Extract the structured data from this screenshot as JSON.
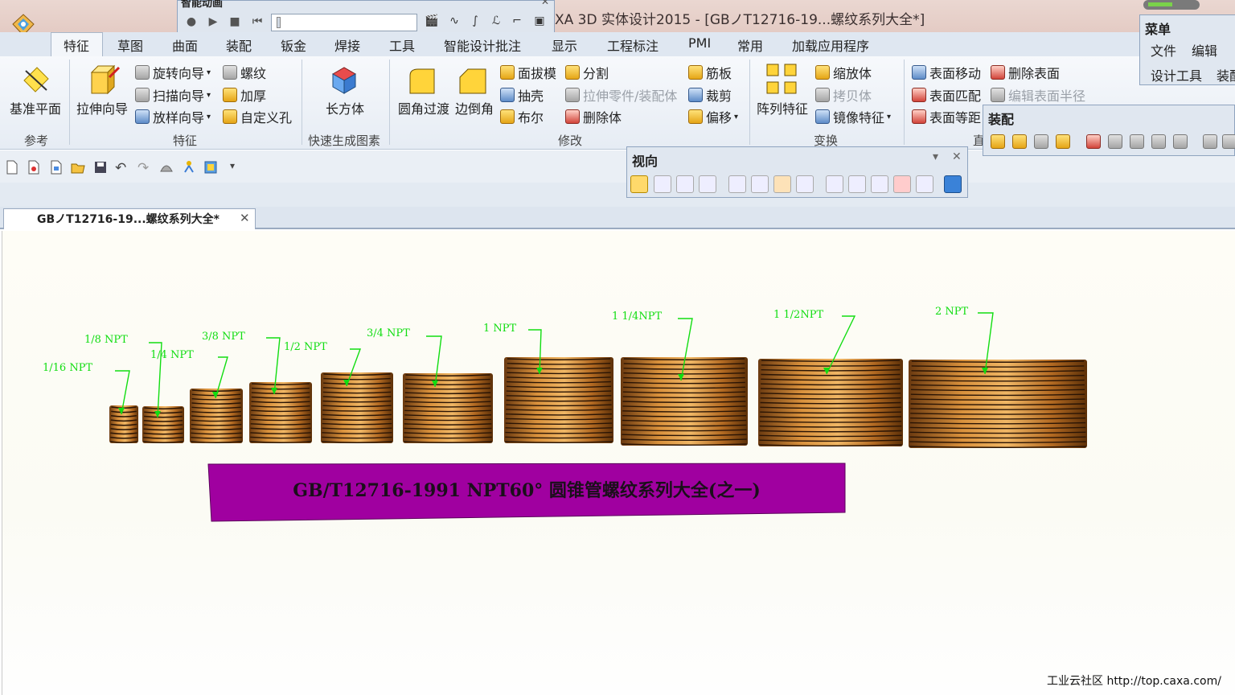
{
  "window": {
    "title": "XA 3D 实体设计2015 - [GBノT12716-19...螺纹系列大全*]"
  },
  "anim_toolbar": {
    "title": "智能动画"
  },
  "menu_tabs": [
    {
      "label": "特征"
    },
    {
      "label": "草图"
    },
    {
      "label": "曲面"
    },
    {
      "label": "装配"
    },
    {
      "label": "钣金"
    },
    {
      "label": "焊接"
    },
    {
      "label": "工具"
    },
    {
      "label": "智能设计批注"
    },
    {
      "label": "显示"
    },
    {
      "label": "工程标注"
    },
    {
      "label": "PMI"
    },
    {
      "label": "常用"
    },
    {
      "label": "加载应用程序"
    }
  ],
  "ribbon": {
    "groups": {
      "reference": "参考",
      "features": "特征",
      "quick": "快速生成图素",
      "modify": "修改",
      "transform": "变换"
    },
    "reference": {
      "datum_plane": "基准平面"
    },
    "features": {
      "extrude_wizard": "拉伸向导",
      "revolve_wizard": "旋转向导",
      "sweep_wizard": "扫描向导",
      "loft_wizard": "放样向导",
      "thread": "螺纹",
      "thicken": "加厚",
      "custom_hole": "自定义孔"
    },
    "quick": {
      "box": "长方体"
    },
    "modify": {
      "fillet": "圆角过渡",
      "chamfer": "边倒角",
      "draft": "面拔模",
      "split": "分割",
      "rib": "筋板",
      "shell": "抽壳",
      "extrude_part": "拉伸零件/装配体",
      "trim": "裁剪",
      "boolean": "布尔",
      "delete_body": "删除体",
      "offset": "偏移"
    },
    "transform": {
      "pattern": "阵列特征",
      "scale": "缩放体",
      "copy": "拷贝体",
      "mirror": "镜像特征"
    },
    "direct_edit": {
      "move_face": "表面移动",
      "match_face": "表面匹配",
      "offset_face": "表面等距",
      "delete_face": "删除表面",
      "edit_radius": "编辑表面半径",
      "group_label_partial": "直"
    }
  },
  "menu_panel": {
    "title": "菜单",
    "items": [
      "文件",
      "编辑",
      "设计工具",
      "装配"
    ]
  },
  "view_panel": {
    "title": "视向"
  },
  "assembly_panel": {
    "title": "装配"
  },
  "document_tab": {
    "label": "GBノT12716-19...螺纹系列大全*"
  },
  "scene": {
    "labels": [
      "1/16 NPT",
      "1/8 NPT",
      "1/4 NPT",
      "3/8 NPT",
      "1/2 NPT",
      "3/4 NPT",
      "1 NPT",
      "1 1/4NPT",
      "1 1/2NPT",
      "2 NPT"
    ],
    "banner": "GB/T12716-1991  NPT60°  圆锥管螺纹系列大全(之一)",
    "colors": {
      "label": "#00dd00",
      "thread": "#c07a2c",
      "banner": "#a000a0"
    }
  },
  "watermark": "工业云社区 http://top.caxa.com/"
}
